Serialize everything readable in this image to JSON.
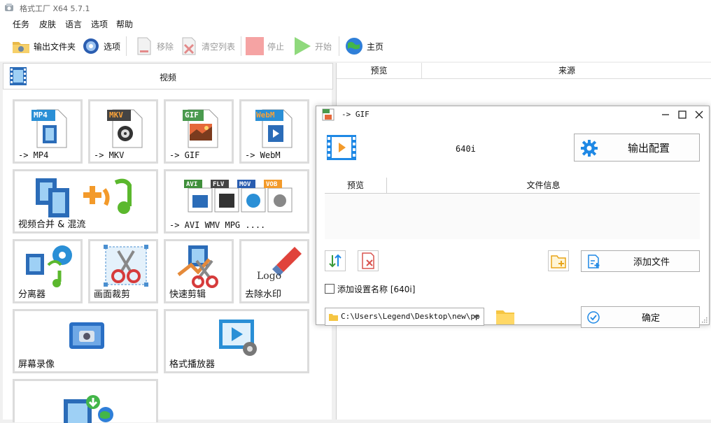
{
  "app": {
    "title": "格式工厂 X64 5.7.1"
  },
  "menu": [
    "任务",
    "皮肤",
    "语言",
    "选项",
    "帮助"
  ],
  "toolbar": {
    "output_folder": "输出文件夹",
    "options": "选项",
    "remove": "移除",
    "clear_list": "清空列表",
    "stop": "停止",
    "start": "开始",
    "home": "主页"
  },
  "category": {
    "label": "视频"
  },
  "tiles": {
    "mp4": {
      "badge": "MP4",
      "label": "-> MP4"
    },
    "mkv": {
      "badge": "MKV",
      "label": "-> MKV"
    },
    "gif": {
      "badge": "GIF",
      "label": "-> GIF"
    },
    "webm": {
      "badge": "WebM",
      "label": "-> WebM"
    },
    "merge": {
      "label": "视频合并 & 混流"
    },
    "multi": {
      "badges": [
        "AVI",
        "FLV",
        "MOV",
        "VOB"
      ],
      "label": "-> AVI WMV MPG ...."
    },
    "splitter": {
      "label": "分离器"
    },
    "crop": {
      "label": "画面裁剪"
    },
    "quick_cut": {
      "label": "快速剪辑"
    },
    "watermark": {
      "label": "去除水印",
      "logo_text": "Logo"
    },
    "screen_record": {
      "label": "屏幕录像"
    },
    "player": {
      "label": "格式播放器"
    }
  },
  "list_headers": {
    "preview": "预览",
    "source": "来源"
  },
  "dialog": {
    "title": "-> GIF",
    "preset": "640i",
    "output_config": "输出配置",
    "table_headers": {
      "preview": "预览",
      "file_info": "文件信息"
    },
    "add_file": "添加文件",
    "add_setting_name": "添加设置名称 [640i]",
    "add_setting_checked": false,
    "output_path": "C:\\Users\\Legend\\Desktop\\new\\pp",
    "ok": "确定"
  },
  "colors": {
    "accent_blue": "#1e88e5",
    "stop_red": "#f28b8b",
    "start_green": "#7ed36b",
    "folder_yellow": "#f5c542"
  }
}
